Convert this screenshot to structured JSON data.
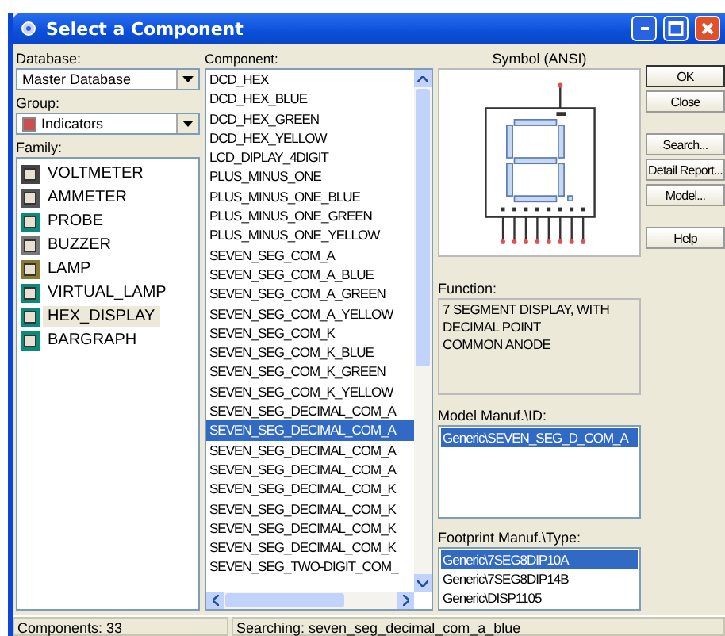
{
  "window": {
    "title": "Select a Component"
  },
  "database": {
    "label": "Database:",
    "value": "Master Database"
  },
  "group": {
    "label": "Group:",
    "value": "Indicators"
  },
  "family": {
    "label": "Family:",
    "items": [
      {
        "label": "VOLTMETER",
        "selected": false
      },
      {
        "label": "AMMETER",
        "selected": false
      },
      {
        "label": "PROBE",
        "selected": false
      },
      {
        "label": "BUZZER",
        "selected": false
      },
      {
        "label": "LAMP",
        "selected": false
      },
      {
        "label": "VIRTUAL_LAMP",
        "selected": false
      },
      {
        "label": "HEX_DISPLAY",
        "selected": true
      },
      {
        "label": "BARGRAPH",
        "selected": false
      }
    ]
  },
  "component": {
    "label": "Component:",
    "items": [
      {
        "label": "DCD_HEX",
        "selected": false
      },
      {
        "label": "DCD_HEX_BLUE",
        "selected": false
      },
      {
        "label": "DCD_HEX_GREEN",
        "selected": false
      },
      {
        "label": "DCD_HEX_YELLOW",
        "selected": false
      },
      {
        "label": "LCD_DIPLAY_4DIGIT",
        "selected": false
      },
      {
        "label": "PLUS_MINUS_ONE",
        "selected": false
      },
      {
        "label": "PLUS_MINUS_ONE_BLUE",
        "selected": false
      },
      {
        "label": "PLUS_MINUS_ONE_GREEN",
        "selected": false
      },
      {
        "label": "PLUS_MINUS_ONE_YELLOW",
        "selected": false
      },
      {
        "label": "SEVEN_SEG_COM_A",
        "selected": false
      },
      {
        "label": "SEVEN_SEG_COM_A_BLUE",
        "selected": false
      },
      {
        "label": "SEVEN_SEG_COM_A_GREEN",
        "selected": false
      },
      {
        "label": "SEVEN_SEG_COM_A_YELLOW",
        "selected": false
      },
      {
        "label": "SEVEN_SEG_COM_K",
        "selected": false
      },
      {
        "label": "SEVEN_SEG_COM_K_BLUE",
        "selected": false
      },
      {
        "label": "SEVEN_SEG_COM_K_GREEN",
        "selected": false
      },
      {
        "label": "SEVEN_SEG_COM_K_YELLOW",
        "selected": false
      },
      {
        "label": "SEVEN_SEG_DECIMAL_COM_A",
        "selected": false
      },
      {
        "label": "SEVEN_SEG_DECIMAL_COM_A",
        "selected": true
      },
      {
        "label": "SEVEN_SEG_DECIMAL_COM_A",
        "selected": false
      },
      {
        "label": "SEVEN_SEG_DECIMAL_COM_A",
        "selected": false
      },
      {
        "label": "SEVEN_SEG_DECIMAL_COM_K",
        "selected": false
      },
      {
        "label": "SEVEN_SEG_DECIMAL_COM_K",
        "selected": false
      },
      {
        "label": "SEVEN_SEG_DECIMAL_COM_K",
        "selected": false
      },
      {
        "label": "SEVEN_SEG_DECIMAL_COM_K",
        "selected": false
      },
      {
        "label": "SEVEN_SEG_TWO-DIGIT_COM_",
        "selected": false
      }
    ]
  },
  "symbol": {
    "title": "Symbol (ANSI)"
  },
  "function": {
    "label": "Function:",
    "text": "7 SEGMENT DISPLAY, WITH\nDECIMAL POINT\nCOMMON ANODE"
  },
  "model": {
    "label": "Model Manuf.\\ID:",
    "items": [
      {
        "label": "Generic\\SEVEN_SEG_D_COM_A",
        "selected": true
      }
    ]
  },
  "footprint": {
    "label": "Footprint Manuf.\\Type:",
    "items": [
      {
        "label": "Generic\\7SEG8DIP10A",
        "selected": true
      },
      {
        "label": "Generic\\7SEG8DIP14B",
        "selected": false
      },
      {
        "label": "Generic\\DISP1105",
        "selected": false
      }
    ]
  },
  "buttons": [
    {
      "label": "OK",
      "kind": "primary"
    },
    {
      "label": "Close",
      "kind": "gap"
    },
    {
      "label": "Search...",
      "kind": "normal"
    },
    {
      "label": "Detail Report...",
      "kind": "normal"
    },
    {
      "label": "Model...",
      "kind": "gap"
    },
    {
      "label": "Help",
      "kind": "normal"
    }
  ],
  "status_bar": {
    "count": "Components: 33",
    "search": "Searching: seven_seg_decimal_com_a_blue"
  }
}
